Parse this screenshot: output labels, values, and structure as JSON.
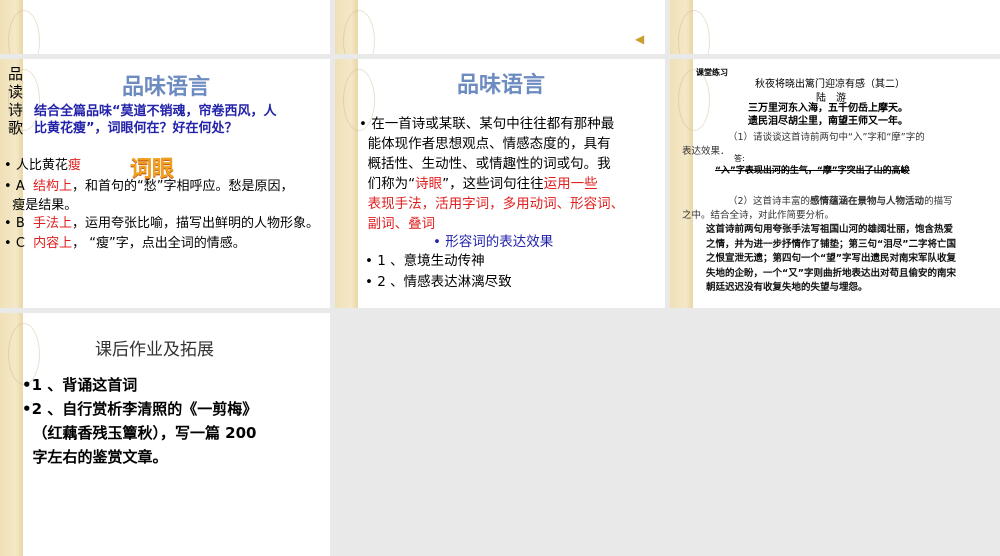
{
  "slides": [
    {
      "id": 1
    },
    {
      "id": 2,
      "sound_icon": "speaker-icon"
    },
    {
      "id": 3
    },
    {
      "id": 4,
      "side_label": [
        "品",
        "读",
        "诗",
        "歌"
      ],
      "title": "品味语言",
      "question": [
        "结合全篇品味“莫道不销魂，帘卷西风，人",
        "比黄花瘦”，词眼何在？好在何处？"
      ],
      "wordart": "词眼",
      "line1_prefix": "人比黄花",
      "line1_red": "瘦",
      "items": [
        {
          "letter": "A",
          "red": "结构上",
          "text": "，和首句的“愁”字相呼应。愁是原因，",
          "text2": "瘦是结果。"
        },
        {
          "letter": "B",
          "red": "手法上",
          "text": "，运用夸张比喻，描写出鲜明的人物形象。"
        },
        {
          "letter": "C",
          "red": "内容上",
          "text": "，  “瘦”字，点出全词的情感。"
        }
      ]
    },
    {
      "id": 5,
      "title": "品味语言",
      "para_lines": [
        "在一首诗或某联、某句中往往都有那种最",
        "能体现作者思想观点、情感态度的，具有",
        "概括性、生动性、或情趣性的词或句。我"
      ],
      "para_l4a": "们称为“",
      "para_l4red": "诗眼",
      "para_l4b": "”，这些词句往往",
      "para_l4red2": "运用一些",
      "red_lines": [
        "表现手法，活用字词，多用动词、形容词、",
        "副词、叠词"
      ],
      "subhead": "形容词的表达效果",
      "points": [
        "1 、意境生动传神",
        "2 、情感表达淋漓尽致"
      ]
    },
    {
      "id": 6,
      "label": "课堂练习",
      "poem_title": "秋夜将晓出篱门迎凉有感（其二）",
      "author": "陆　游",
      "poem": [
        "三万里河东入海，五千仞岳上摩天。",
        "遗民泪尽胡尘里，南望王师又一年。"
      ],
      "q1": "（1）请谈谈这首诗前两句中“入”字和“摩”字的",
      "q1b": "表达效果．",
      "ans_label": "答:",
      "a1": "“入”字表现出河的生气，“摩”字突出了山的高峻",
      "q2a": "（2）这首诗丰富的",
      "q2bold": "感情蕴涵在景物与人物活动",
      "q2b": "的描写",
      "q2c": "之中。结合全诗，对此作简要分析。",
      "a2": "这首诗前两句用夸张手法写祖国山河的雄阔壮丽，饱含热爱之情，并为进一步抒情作了铺垫；第三句“泪尽”二字将亡国之恨宣泄无遗；第四句一个“望”字写出遗民对南宋军队收复失地的企盼，一个“又”字则曲折地表达出对苟且偷安的南宋朝廷迟迟没有收复失地的失望与埋怨。"
    },
    {
      "id": 7,
      "title": "课后作业及拓展",
      "items": [
        "1 、背诵这首词",
        "2 、自行赏析李清照的《一剪梅》"
      ],
      "item2_lines": [
        "（红藕香残玉簟秋），写一篇 200",
        "字左右的鉴赏文章。"
      ]
    }
  ]
}
